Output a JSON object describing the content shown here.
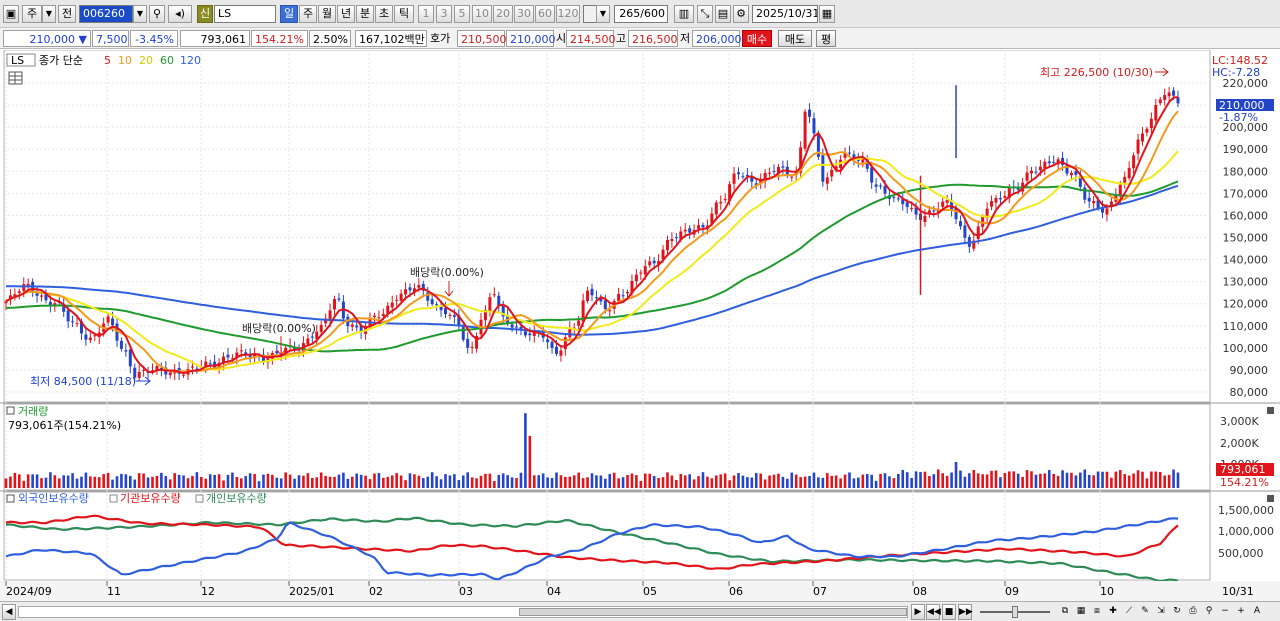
{
  "toolbar": {
    "type_label": "주",
    "prev_label": "전",
    "stock_code": "006260",
    "stock_name": "LS",
    "new_badge": "신",
    "periods": [
      "일",
      "주",
      "월",
      "년",
      "분",
      "초",
      "틱"
    ],
    "active_period": "일",
    "intervals": [
      "1",
      "3",
      "5",
      "10",
      "20",
      "30",
      "60",
      "120"
    ],
    "count_value": "265",
    "count_total": "/600",
    "date_value": "2025/10/31"
  },
  "quote": {
    "price": "210,000",
    "change_arrow": "▼",
    "change": "7,500",
    "change_pct": "-3.45%",
    "volume": "793,061",
    "volume_ratio": "154.21%",
    "turnover": "2.50%",
    "amount": "167,102백만",
    "bid_label": "호가",
    "bid1": "210,500",
    "bid2": "210,000",
    "open_label": "시",
    "open": "214,500",
    "high_label": "고",
    "high": "216,500",
    "low_label": "저",
    "low": "206,000",
    "buy_label": "매수",
    "sell_label": "매도",
    "eval_label": "평"
  },
  "legend": {
    "symbol": "LS",
    "ma_title": "종가 단순",
    "ma_periods": [
      "5",
      "10",
      "20",
      "60",
      "120"
    ]
  },
  "colors": {
    "ma5": "#e0141a",
    "ma10": "#f39a1c",
    "ma20": "#f2ea1a",
    "ma60": "#1f9a2f",
    "ma120": "#2f5fdc",
    "up": "#e0141a",
    "down": "#2445c8",
    "foreign": "#2f5fdc",
    "institution": "#e0141a",
    "individual": "#2e8b57"
  },
  "price_axis": {
    "labels": [
      "220,000",
      "210,000",
      "200,000",
      "190,000",
      "180,000",
      "170,000",
      "160,000",
      "150,000",
      "140,000",
      "130,000",
      "120,000",
      "110,000",
      "100,000",
      "90,000",
      "80,000"
    ],
    "lc": "LC:148.52",
    "hc": "HC:-7.28",
    "current": "210,000",
    "current_pct": "-1.87%"
  },
  "annotations": {
    "high": "최고 226,500 (10/30)",
    "low": "최저 84,500 (11/18)",
    "ex_div1": "배당락(0.00%)",
    "ex_div2": "배당락(0.00%)"
  },
  "volume_pane": {
    "title": "거래량",
    "value": "793,061주(154.21%)",
    "axis": [
      "3,000K",
      "2,000K",
      "1,000K"
    ],
    "current": "793,061",
    "current_pct": "154.21%"
  },
  "holdings_pane": {
    "foreign": "외국인보유수량",
    "institution": "기관보유수량",
    "individual": "개인보유수량",
    "axis": [
      "1,500,000",
      "1,000,000",
      "500,000"
    ]
  },
  "x_axis": {
    "labels": [
      "2024/09",
      "11",
      "12",
      "2025/01",
      "02",
      "03",
      "04",
      "05",
      "06",
      "07",
      "08",
      "09",
      "10"
    ],
    "end": "10/31"
  },
  "chart_data": {
    "type": "candlestick",
    "title": "LS",
    "series": [
      {
        "name": "5"
      },
      {
        "name": "10"
      },
      {
        "name": "20"
      },
      {
        "name": "60"
      },
      {
        "name": "120"
      }
    ],
    "ylim": [
      80000,
      226500
    ],
    "high": {
      "value": 226500,
      "date": "10/30"
    },
    "low": {
      "value": 84500,
      "date": "11/18"
    },
    "monthly_close": [
      {
        "x": "2024/09",
        "y": 120000
      },
      {
        "x": "11",
        "y": 88000
      },
      {
        "x": "12",
        "y": 93000
      },
      {
        "x": "2025/01",
        "y": 100000
      },
      {
        "x": "02",
        "y": 118000
      },
      {
        "x": "03",
        "y": 118000
      },
      {
        "x": "04",
        "y": 100000
      },
      {
        "x": "05",
        "y": 140000
      },
      {
        "x": "06",
        "y": 180000
      },
      {
        "x": "07",
        "y": 185000
      },
      {
        "x": "08",
        "y": 160000
      },
      {
        "x": "09",
        "y": 183000
      },
      {
        "x": "10",
        "y": 210000
      }
    ]
  }
}
